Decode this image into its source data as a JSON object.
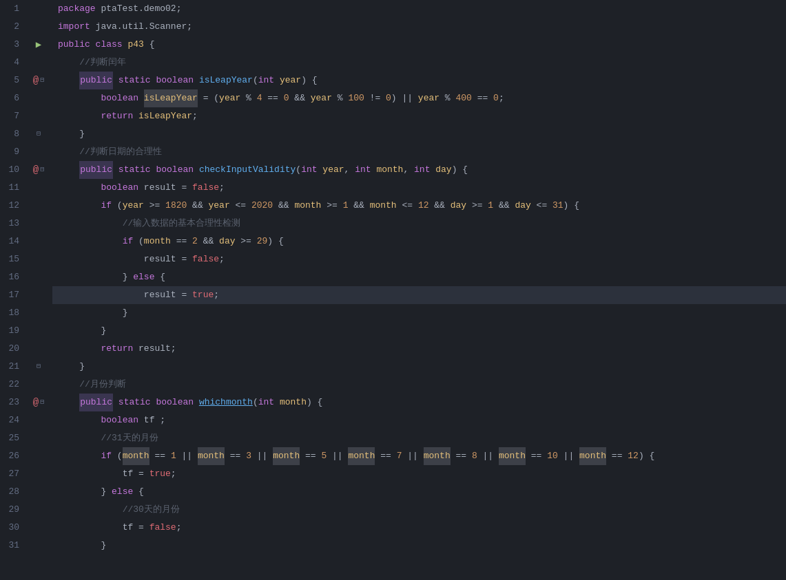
{
  "editor": {
    "background": "#1e2127",
    "lines": [
      {
        "num": 1,
        "indent": 0,
        "content": "package ptaTest.demo02;"
      },
      {
        "num": 2,
        "indent": 0,
        "content": "import java.util.Scanner;"
      },
      {
        "num": 3,
        "indent": 0,
        "content": "public class p43 {",
        "gutter": "run"
      },
      {
        "num": 4,
        "indent": 4,
        "content": "//判断闰年"
      },
      {
        "num": 5,
        "indent": 4,
        "content": "public static boolean isLeapYear(int year) {",
        "gutter": "debug+fold"
      },
      {
        "num": 6,
        "indent": 8,
        "content": "boolean isLeapYear = (year % 4 == 0 && year % 100 != 0) || year % 400 == 0;"
      },
      {
        "num": 7,
        "indent": 8,
        "content": "return isLeapYear;"
      },
      {
        "num": 8,
        "indent": 4,
        "content": "}",
        "gutter": "fold"
      },
      {
        "num": 9,
        "indent": 4,
        "content": "//判断日期的合理性"
      },
      {
        "num": 10,
        "indent": 4,
        "content": "public static boolean checkInputValidity(int year, int month, int day) {",
        "gutter": "debug+fold"
      },
      {
        "num": 11,
        "indent": 8,
        "content": "boolean result = false;"
      },
      {
        "num": 12,
        "indent": 8,
        "content": "if (year >= 1820 && year <= 2020 && month >= 1 && month <= 12 && day >= 1 && day <= 31) {"
      },
      {
        "num": 13,
        "indent": 12,
        "content": "//输入数据的基本合理性检测"
      },
      {
        "num": 14,
        "indent": 12,
        "content": "if (month == 2 && day >= 29) {"
      },
      {
        "num": 15,
        "indent": 16,
        "content": "result = false;"
      },
      {
        "num": 16,
        "indent": 12,
        "content": "} else {"
      },
      {
        "num": 17,
        "indent": 16,
        "content": "result = true;",
        "active": true
      },
      {
        "num": 18,
        "indent": 12,
        "content": "}"
      },
      {
        "num": 19,
        "indent": 8,
        "content": "}"
      },
      {
        "num": 20,
        "indent": 8,
        "content": "return result;"
      },
      {
        "num": 21,
        "indent": 4,
        "content": "}",
        "gutter": "fold"
      },
      {
        "num": 22,
        "indent": 4,
        "content": "//月份判断"
      },
      {
        "num": 23,
        "indent": 4,
        "content": "public static boolean whichmonth(int month) {",
        "gutter": "debug+fold"
      },
      {
        "num": 24,
        "indent": 8,
        "content": "boolean tf ;"
      },
      {
        "num": 25,
        "indent": 8,
        "content": "//31天的月份"
      },
      {
        "num": 26,
        "indent": 8,
        "content": "if (month == 1 || month == 3 || month == 5 || month == 7 || month == 8 || month == 10 || month == 12) {"
      },
      {
        "num": 27,
        "indent": 12,
        "content": "tf = true;"
      },
      {
        "num": 28,
        "indent": 8,
        "content": "} else {"
      },
      {
        "num": 29,
        "indent": 12,
        "content": "//30天的月份"
      },
      {
        "num": 30,
        "indent": 12,
        "content": "tf = false;"
      },
      {
        "num": 31,
        "indent": 8,
        "content": "}"
      }
    ]
  }
}
